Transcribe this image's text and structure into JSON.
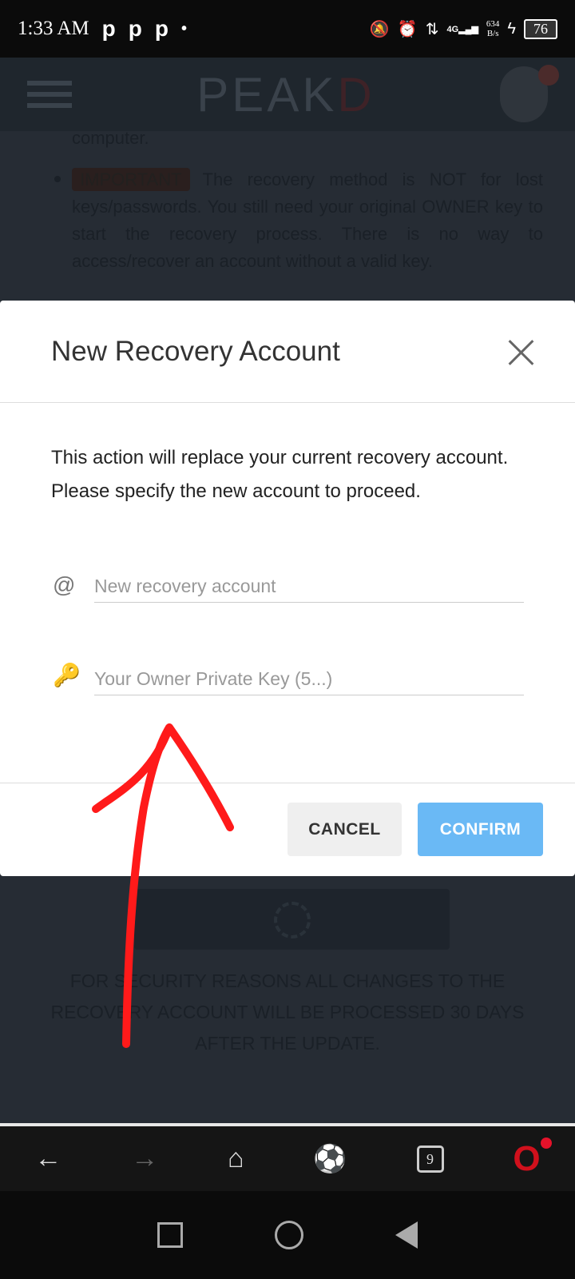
{
  "status_bar": {
    "time": "1:33 AM",
    "notif_icons": [
      "p",
      "p",
      "p"
    ],
    "net_speed_value": "634",
    "net_speed_unit": "B/s",
    "network": "4G",
    "battery": "76"
  },
  "header": {
    "logo_main": "PEAK",
    "logo_accent": "D"
  },
  "background": {
    "text_fragment": "computer.",
    "badge": "IMPORTANT",
    "important_text": "The recovery method is NOT for lost keys/passwords. You still need your original OWNER key to start the recovery process. There is no way to access/recover an account without a valid key.",
    "notice": "FOR SECURITY REASONS ALL CHANGES TO THE RECOVERY ACCOUNT WILL BE PROCESSED 30 DAYS AFTER THE UPDATE."
  },
  "modal": {
    "title": "New Recovery Account",
    "description": "This action will replace your current recovery account. Please specify the new account to proceed.",
    "account_field": {
      "placeholder": "New recovery account",
      "value": "",
      "icon": "at-icon"
    },
    "key_field": {
      "placeholder": "Your Owner Private Key (5...)",
      "value": "",
      "icon": "key-icon"
    },
    "cancel_label": "CANCEL",
    "confirm_label": "CONFIRM"
  },
  "browser_nav": {
    "tab_count": "9"
  },
  "colors": {
    "confirm": "#6ab9f5",
    "annotation": "#ff1a1a",
    "opera": "#d0101c"
  }
}
